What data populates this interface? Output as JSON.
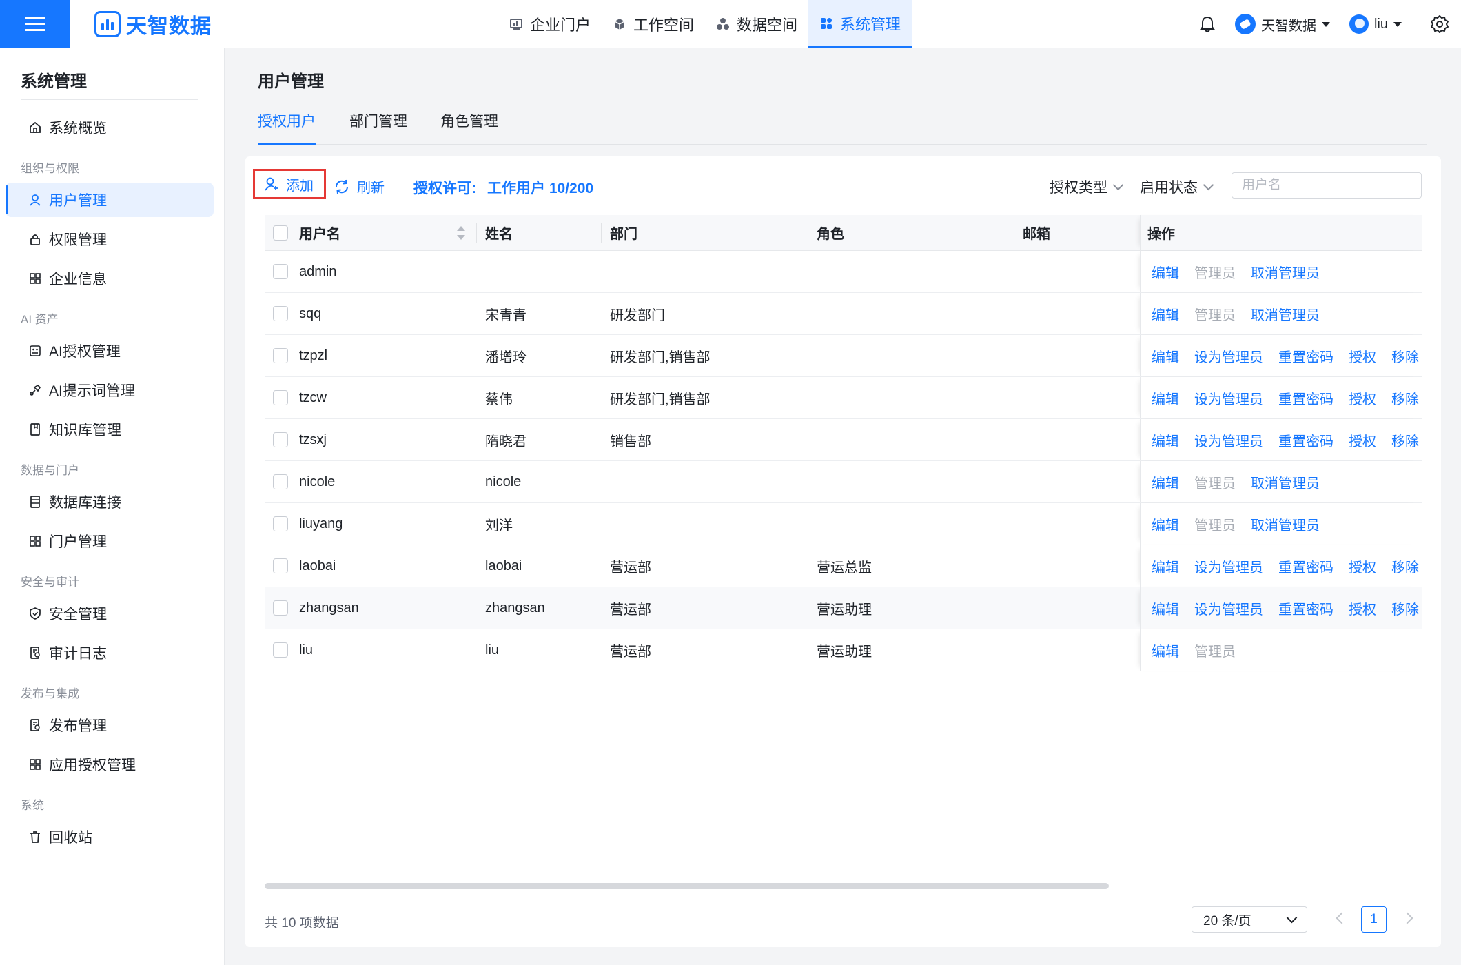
{
  "brand": {
    "name": "天智数据",
    "accent": "#1677ff"
  },
  "topnav": [
    {
      "label": "企业门户",
      "icon": "chart-board-icon"
    },
    {
      "label": "工作空间",
      "icon": "cube-icon"
    },
    {
      "label": "数据空间",
      "icon": "cluster-icon"
    },
    {
      "label": "系统管理",
      "icon": "grid-icon",
      "active": true
    }
  ],
  "header_right": {
    "org_name": "天智数据",
    "user_name": "liu"
  },
  "sidebar": {
    "title": "系统管理",
    "overview": "系统概览",
    "groups": [
      {
        "title": "组织与权限",
        "items": [
          "用户管理",
          "权限管理",
          "企业信息"
        ]
      },
      {
        "title": "AI 资产",
        "items": [
          "AI授权管理",
          "AI提示词管理",
          "知识库管理"
        ]
      },
      {
        "title": "数据与门户",
        "items": [
          "数据库连接",
          "门户管理"
        ]
      },
      {
        "title": "安全与审计",
        "items": [
          "安全管理",
          "审计日志"
        ]
      },
      {
        "title": "发布与集成",
        "items": [
          "发布管理",
          "应用授权管理"
        ]
      },
      {
        "title": "系统",
        "items": [
          "回收站"
        ]
      }
    ]
  },
  "page": {
    "title": "用户管理",
    "tabs": [
      "授权用户",
      "部门管理",
      "角色管理"
    ]
  },
  "toolbar": {
    "add": "添加",
    "refresh": "刷新",
    "license_label": "授权许可:",
    "license_value": "工作用户 10/200",
    "filter_type": "授权类型",
    "filter_status": "启用状态",
    "search_placeholder": "用户名"
  },
  "table": {
    "columns": [
      "用户名",
      "姓名",
      "部门",
      "角色",
      "邮箱",
      "操作"
    ],
    "rows": [
      {
        "username": "admin",
        "name": "",
        "dept": "",
        "role": "",
        "email": "",
        "ops": [
          "编辑",
          "管理员",
          "取消管理员"
        ]
      },
      {
        "username": "sqq",
        "name": "宋青青",
        "dept": "研发部门",
        "role": "",
        "email": "",
        "ops": [
          "编辑",
          "管理员",
          "取消管理员"
        ]
      },
      {
        "username": "tzpzl",
        "name": "潘增玲",
        "dept": "研发部门,销售部",
        "role": "",
        "email": "",
        "ops": [
          "编辑",
          "设为管理员",
          "重置密码",
          "授权",
          "移除"
        ]
      },
      {
        "username": "tzcw",
        "name": "蔡伟",
        "dept": "研发部门,销售部",
        "role": "",
        "email": "",
        "ops": [
          "编辑",
          "设为管理员",
          "重置密码",
          "授权",
          "移除"
        ]
      },
      {
        "username": "tzsxj",
        "name": "隋晓君",
        "dept": "销售部",
        "role": "",
        "email": "",
        "ops": [
          "编辑",
          "设为管理员",
          "重置密码",
          "授权",
          "移除"
        ]
      },
      {
        "username": "nicole",
        "name": "nicole",
        "dept": "",
        "role": "",
        "email": "",
        "ops": [
          "编辑",
          "管理员",
          "取消管理员"
        ]
      },
      {
        "username": "liuyang",
        "name": "刘洋",
        "dept": "",
        "role": "",
        "email": "",
        "ops": [
          "编辑",
          "管理员",
          "取消管理员"
        ]
      },
      {
        "username": "laobai",
        "name": "laobai",
        "dept": "营运部",
        "role": "营运总监",
        "email": "",
        "ops": [
          "编辑",
          "设为管理员",
          "重置密码",
          "授权",
          "移除"
        ]
      },
      {
        "username": "zhangsan",
        "name": "zhangsan",
        "dept": "营运部",
        "role": "营运助理",
        "email": "",
        "ops": [
          "编辑",
          "设为管理员",
          "重置密码",
          "授权",
          "移除"
        ]
      },
      {
        "username": "liu",
        "name": "liu",
        "dept": "营运部",
        "role": "营运助理",
        "email": "",
        "ops": [
          "编辑",
          "管理员"
        ]
      }
    ]
  },
  "pagination": {
    "total": "共 10 项数据",
    "page_size": "20 条/页",
    "current_page": "1"
  }
}
